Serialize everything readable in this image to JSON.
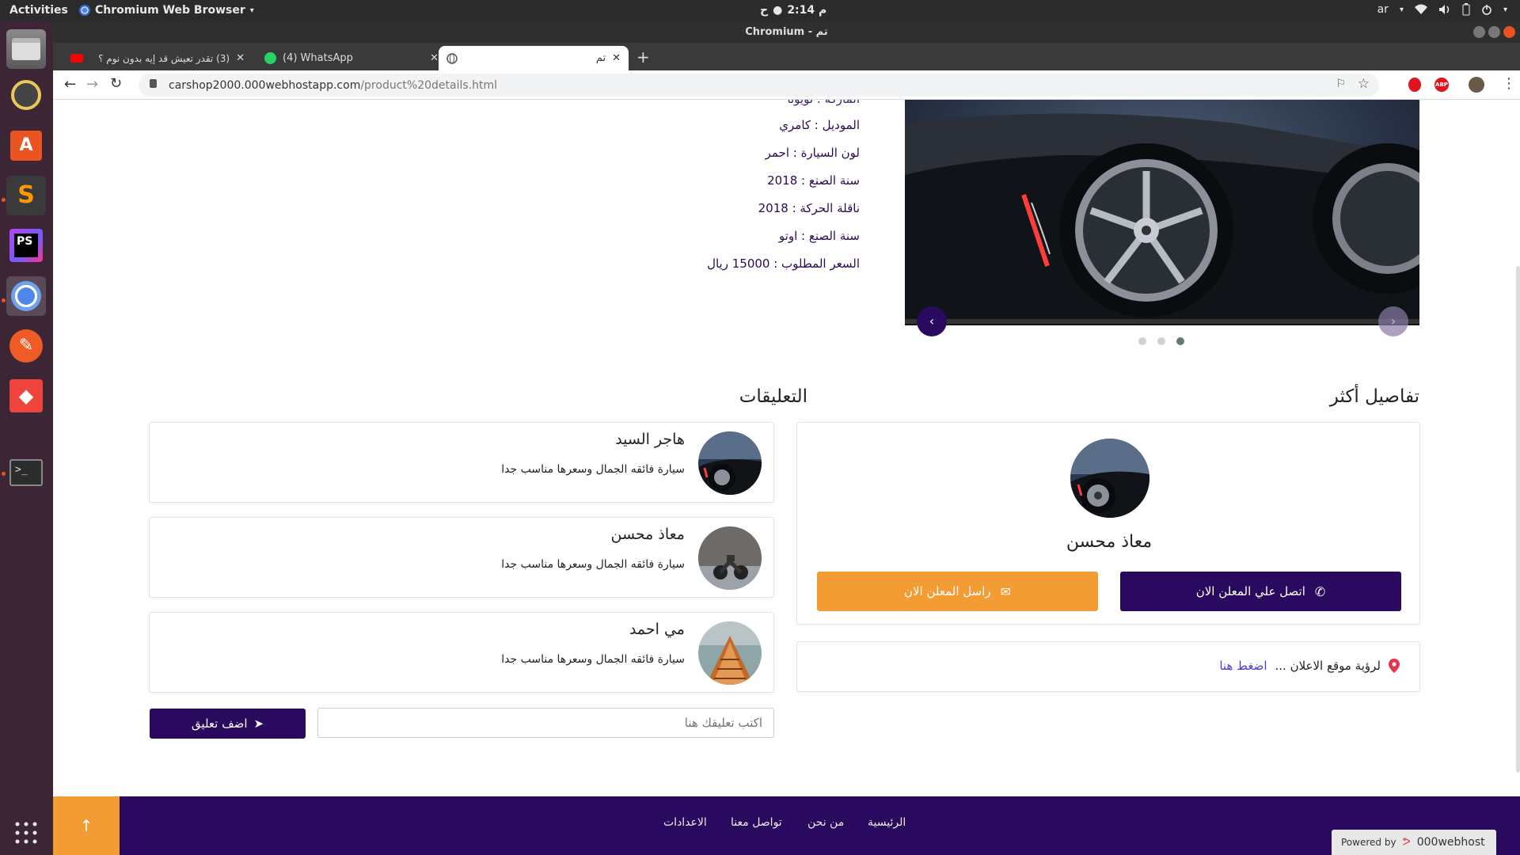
{
  "gnome": {
    "activities": "Activities",
    "app_name": "Chromium Web Browser",
    "clock": "2:14 م",
    "clock_prefix": "ح",
    "lang": "ar"
  },
  "window": {
    "title": "Chromium - تم"
  },
  "tabs": [
    {
      "label": "(3) تقدر تعيش قد إيه بدون نوم ؟",
      "icon": "youtube-icon"
    },
    {
      "label": "(4) WhatsApp",
      "icon": "whatsapp-icon"
    },
    {
      "label": "تم",
      "icon": "globe-icon"
    }
  ],
  "address": {
    "host": "carshop2000.000webhostapp.com",
    "path": "/product%20details.html"
  },
  "specs": [
    "الموديل : كامري",
    "لون السيارة : احمر",
    "سنة الصنع : 2018",
    "ناقلة الحركة : 2018",
    "سنة الصنع : اوتو",
    "السعر المطلوب : 15000 ريال"
  ],
  "slider": {
    "prev": "‹",
    "next": "›"
  },
  "details": {
    "heading": "تفاصيل أكثر",
    "seller_name": "معاذ محسن",
    "call_label": "اتصل علي المعلن الان",
    "message_label": "راسل المعلن الان",
    "location_text": "لرؤية موقع الاعلان ...",
    "location_link": "اضغط هنا"
  },
  "comments": {
    "heading": "التعليقات",
    "items": [
      {
        "name": "هاجر السيد",
        "text": "سيارة فائقه الجمال وسعرها مناسب جدا"
      },
      {
        "name": "معاذ محسن",
        "text": "سيارة فائقه الجمال وسعرها مناسب جدا"
      },
      {
        "name": "مي احمد",
        "text": "سيارة فائقه الجمال وسعرها مناسب جدا"
      }
    ],
    "input_placeholder": "اكتب تعليقك هنا",
    "submit_label": "اضف تعليق"
  },
  "footer": {
    "links": [
      "الرئيسية",
      "من نحن",
      "تواصل معنا",
      "الاعدادات"
    ],
    "powered_prefix": "Powered by",
    "powered_brand": "000webhost"
  },
  "colors": {
    "primary": "#2a0a5e",
    "accent": "#f39c33",
    "pin": "#e8334a"
  }
}
